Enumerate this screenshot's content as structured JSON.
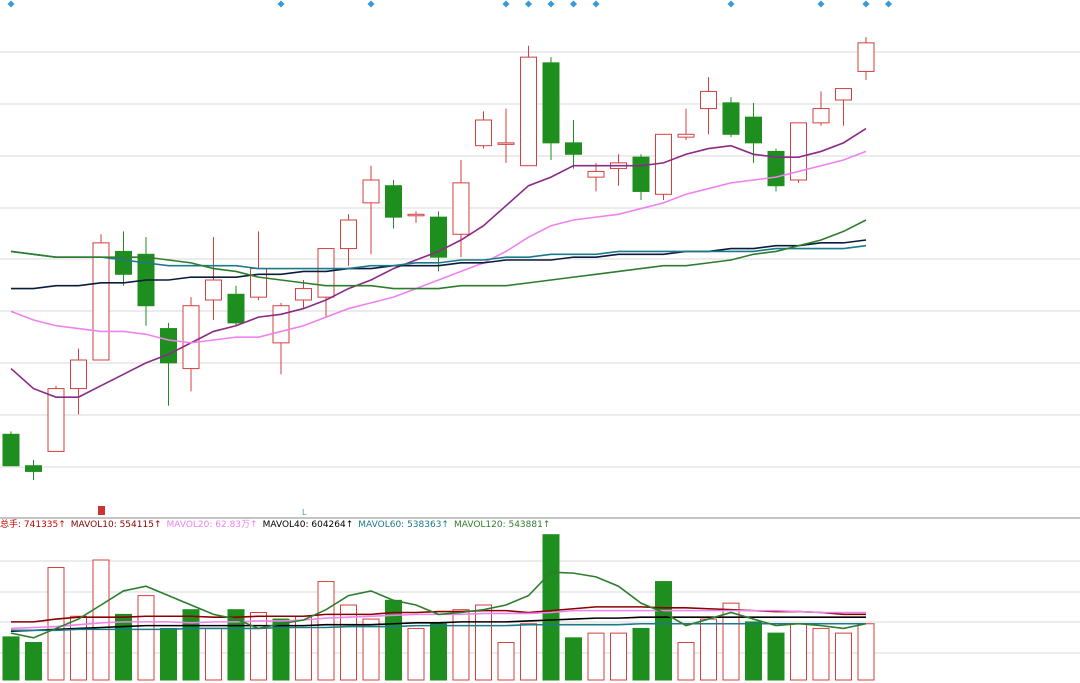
{
  "chart_data": {
    "type": "candlestick",
    "title": "",
    "grid": true,
    "main": {
      "candles": [
        {
          "o": 3.33,
          "h": 3.34,
          "l": 3.26,
          "c": 3.22
        },
        {
          "o": 3.22,
          "h": 3.24,
          "l": 3.17,
          "c": 3.2
        },
        {
          "o": 3.27,
          "h": 3.5,
          "l": 3.27,
          "c": 3.49
        },
        {
          "o": 3.49,
          "h": 3.63,
          "l": 3.4,
          "c": 3.59
        },
        {
          "o": 3.59,
          "h": 4.03,
          "l": 3.8,
          "c": 4.0
        },
        {
          "o": 3.97,
          "h": 4.04,
          "l": 3.85,
          "c": 3.89
        },
        {
          "o": 3.96,
          "h": 4.02,
          "l": 3.71,
          "c": 3.78
        },
        {
          "o": 3.7,
          "h": 3.72,
          "l": 3.43,
          "c": 3.58
        },
        {
          "o": 3.56,
          "h": 3.81,
          "l": 3.48,
          "c": 3.78
        },
        {
          "o": 3.8,
          "h": 4.02,
          "l": 3.73,
          "c": 3.87
        },
        {
          "o": 3.82,
          "h": 3.85,
          "l": 3.71,
          "c": 3.72
        },
        {
          "o": 3.81,
          "h": 4.04,
          "l": 3.8,
          "c": 3.91
        },
        {
          "o": 3.65,
          "h": 3.79,
          "l": 3.54,
          "c": 3.78
        },
        {
          "o": 3.8,
          "h": 3.87,
          "l": 3.77,
          "c": 3.84
        },
        {
          "o": 3.81,
          "h": 3.97,
          "l": 3.74,
          "c": 3.98
        },
        {
          "o": 3.98,
          "h": 4.1,
          "l": 3.92,
          "c": 4.08
        },
        {
          "o": 4.14,
          "h": 4.27,
          "l": 3.96,
          "c": 4.22
        },
        {
          "o": 4.2,
          "h": 4.22,
          "l": 4.05,
          "c": 4.09
        },
        {
          "o": 4.1,
          "h": 4.11,
          "l": 4.07,
          "c": 4.1
        },
        {
          "o": 4.09,
          "h": 4.11,
          "l": 3.9,
          "c": 3.95
        },
        {
          "o": 4.03,
          "h": 4.29,
          "l": 3.95,
          "c": 4.21
        },
        {
          "o": 4.34,
          "h": 4.46,
          "l": 4.33,
          "c": 4.43
        },
        {
          "o": 4.35,
          "h": 4.47,
          "l": 4.28,
          "c": 4.35
        },
        {
          "o": 4.27,
          "h": 4.69,
          "l": 4.27,
          "c": 4.65
        },
        {
          "o": 4.63,
          "h": 4.65,
          "l": 4.29,
          "c": 4.35
        },
        {
          "o": 4.35,
          "h": 4.43,
          "l": 4.26,
          "c": 4.31
        },
        {
          "o": 4.23,
          "h": 4.28,
          "l": 4.18,
          "c": 4.25
        },
        {
          "o": 4.26,
          "h": 4.31,
          "l": 4.2,
          "c": 4.28
        },
        {
          "o": 4.3,
          "h": 4.31,
          "l": 4.15,
          "c": 4.18
        },
        {
          "o": 4.17,
          "h": 4.33,
          "l": 4.15,
          "c": 4.38
        },
        {
          "o": 4.37,
          "h": 4.47,
          "l": 4.36,
          "c": 4.38
        },
        {
          "o": 4.47,
          "h": 4.58,
          "l": 4.38,
          "c": 4.53
        },
        {
          "o": 4.49,
          "h": 4.51,
          "l": 4.37,
          "c": 4.38
        },
        {
          "o": 4.44,
          "h": 4.49,
          "l": 4.28,
          "c": 4.35
        },
        {
          "o": 4.32,
          "h": 4.33,
          "l": 4.18,
          "c": 4.2
        },
        {
          "o": 4.22,
          "h": 4.42,
          "l": 4.21,
          "c": 4.42
        },
        {
          "o": 4.42,
          "h": 4.53,
          "l": 4.41,
          "c": 4.47
        },
        {
          "o": 4.5,
          "h": 4.54,
          "l": 4.41,
          "c": 4.54
        },
        {
          "o": 4.6,
          "h": 4.72,
          "l": 4.57,
          "c": 4.7
        }
      ],
      "ma_lines": [
        {
          "color": "#8b2a87",
          "values": [
            3.56,
            3.49,
            3.46,
            3.46,
            3.5,
            3.54,
            3.58,
            3.61,
            3.65,
            3.69,
            3.71,
            3.74,
            3.75,
            3.77,
            3.8,
            3.84,
            3.87,
            3.91,
            3.94,
            3.97,
            4.01,
            4.06,
            4.13,
            4.2,
            4.23,
            4.27,
            4.27,
            4.27,
            4.27,
            4.28,
            4.31,
            4.33,
            4.34,
            4.31,
            4.3,
            4.3,
            4.32,
            4.35,
            4.4
          ]
        },
        {
          "color": "#ee82ee",
          "values": [
            3.76,
            3.73,
            3.71,
            3.7,
            3.69,
            3.69,
            3.68,
            3.66,
            3.65,
            3.66,
            3.67,
            3.67,
            3.69,
            3.71,
            3.74,
            3.77,
            3.79,
            3.81,
            3.84,
            3.87,
            3.9,
            3.93,
            3.97,
            4.02,
            4.06,
            4.08,
            4.09,
            4.1,
            4.12,
            4.14,
            4.17,
            4.19,
            4.21,
            4.22,
            4.23,
            4.25,
            4.27,
            4.29,
            4.32
          ]
        },
        {
          "color": "#0a1c3c",
          "values": [
            3.84,
            3.84,
            3.85,
            3.85,
            3.86,
            3.86,
            3.87,
            3.87,
            3.88,
            3.88,
            3.88,
            3.89,
            3.89,
            3.9,
            3.9,
            3.91,
            3.91,
            3.92,
            3.92,
            3.92,
            3.93,
            3.93,
            3.94,
            3.94,
            3.94,
            3.95,
            3.95,
            3.96,
            3.96,
            3.96,
            3.97,
            3.97,
            3.98,
            3.98,
            3.99,
            3.99,
            4.0,
            4.0,
            4.01
          ]
        },
        {
          "color": "#1a7a8a",
          "values": [
            3.97,
            3.96,
            3.95,
            3.95,
            3.95,
            3.94,
            3.93,
            3.92,
            3.92,
            3.92,
            3.92,
            3.91,
            3.91,
            3.91,
            3.91,
            3.91,
            3.92,
            3.92,
            3.93,
            3.93,
            3.94,
            3.94,
            3.95,
            3.95,
            3.96,
            3.96,
            3.96,
            3.97,
            3.97,
            3.97,
            3.97,
            3.97,
            3.97,
            3.97,
            3.98,
            3.98,
            3.98,
            3.98,
            3.99
          ]
        },
        {
          "color": "#2e7d2e",
          "values": [
            3.97,
            3.96,
            3.95,
            3.95,
            3.95,
            3.95,
            3.95,
            3.94,
            3.93,
            3.91,
            3.9,
            3.88,
            3.87,
            3.86,
            3.85,
            3.85,
            3.85,
            3.84,
            3.84,
            3.84,
            3.85,
            3.85,
            3.85,
            3.86,
            3.87,
            3.88,
            3.89,
            3.9,
            3.91,
            3.92,
            3.92,
            3.93,
            3.94,
            3.96,
            3.97,
            3.99,
            4.01,
            4.04,
            4.08
          ]
        }
      ]
    },
    "volume": {
      "legend": [
        {
          "label": "总手: 741335↑",
          "color": "#cc0000"
        },
        {
          "label": "MAVOL10: 554115↑",
          "color": "#8b0000"
        },
        {
          "label": "MAVOL20: 62.83万↑",
          "color": "#ee82ee"
        },
        {
          "label": "MAVOL40: 604264↑",
          "color": "#000000"
        },
        {
          "label": "MAVOL60: 538363↑",
          "color": "#1a7a8a"
        },
        {
          "label": "MAVOL120: 543881↑",
          "color": "#2e7d2e"
        }
      ],
      "values": [
        46,
        40,
        120,
        68,
        128,
        70,
        90,
        55,
        75,
        55,
        75,
        72,
        65,
        68,
        105,
        80,
        65,
        85,
        55,
        60,
        75,
        80,
        40,
        60,
        155,
        45,
        50,
        50,
        55,
        105,
        40,
        65,
        82,
        62,
        50,
        60,
        55,
        50,
        60
      ],
      "up": [
        false,
        false,
        true,
        true,
        true,
        false,
        true,
        false,
        false,
        true,
        false,
        true,
        false,
        true,
        true,
        true,
        true,
        false,
        true,
        false,
        true,
        true,
        true,
        true,
        false,
        false,
        true,
        true,
        false,
        false,
        true,
        true,
        true,
        false,
        false,
        true,
        true,
        true,
        true
      ],
      "ma_lines": [
        {
          "color": "#8b0000",
          "values": [
            62,
            62,
            65,
            67,
            67,
            67,
            68,
            68,
            68,
            67,
            67,
            68,
            68,
            68,
            70,
            70,
            70,
            72,
            72,
            73,
            73,
            74,
            74,
            72,
            74,
            76,
            78,
            78,
            78,
            77,
            77,
            76,
            75,
            74,
            73,
            73,
            72,
            70,
            70
          ]
        },
        {
          "color": "#ee82ee",
          "values": [
            55,
            56,
            57,
            59,
            61,
            62,
            62,
            62,
            61,
            62,
            62,
            63,
            63,
            64,
            66,
            67,
            68,
            69,
            70,
            70,
            70,
            71,
            71,
            71,
            72,
            74,
            74,
            74,
            74,
            74,
            74,
            74,
            74,
            74,
            74,
            73,
            72,
            72,
            72
          ]
        },
        {
          "color": "#000000",
          "values": [
            52,
            53,
            54,
            55,
            56,
            57,
            58,
            58,
            58,
            58,
            58,
            58,
            58,
            58,
            59,
            59,
            59,
            60,
            61,
            61,
            62,
            62,
            62,
            63,
            64,
            65,
            66,
            66,
            67,
            67,
            67,
            67,
            67,
            67,
            67,
            67,
            67,
            67,
            67
          ]
        },
        {
          "color": "#1a7a8a",
          "values": [
            53,
            53,
            53,
            54,
            54,
            54,
            54,
            54,
            55,
            55,
            55,
            55,
            56,
            56,
            56,
            57,
            57,
            57,
            58,
            58,
            58,
            58,
            58,
            59,
            59,
            59,
            59,
            59,
            60,
            60,
            60,
            60,
            60,
            60,
            60,
            60,
            60,
            60,
            60
          ]
        },
        {
          "color": "#2e7d2e",
          "values": [
            50,
            45,
            55,
            65,
            80,
            95,
            100,
            90,
            80,
            70,
            65,
            55,
            60,
            64,
            75,
            90,
            95,
            85,
            80,
            70,
            72,
            75,
            80,
            90,
            115,
            114,
            110,
            100,
            82,
            72,
            58,
            65,
            72,
            65,
            58,
            60,
            58,
            55,
            60
          ]
        }
      ]
    },
    "marker_indices": [
      0,
      12,
      16,
      22,
      23,
      24,
      25,
      26,
      32,
      36,
      38,
      39
    ],
    "small_labels": [
      "L"
    ]
  }
}
